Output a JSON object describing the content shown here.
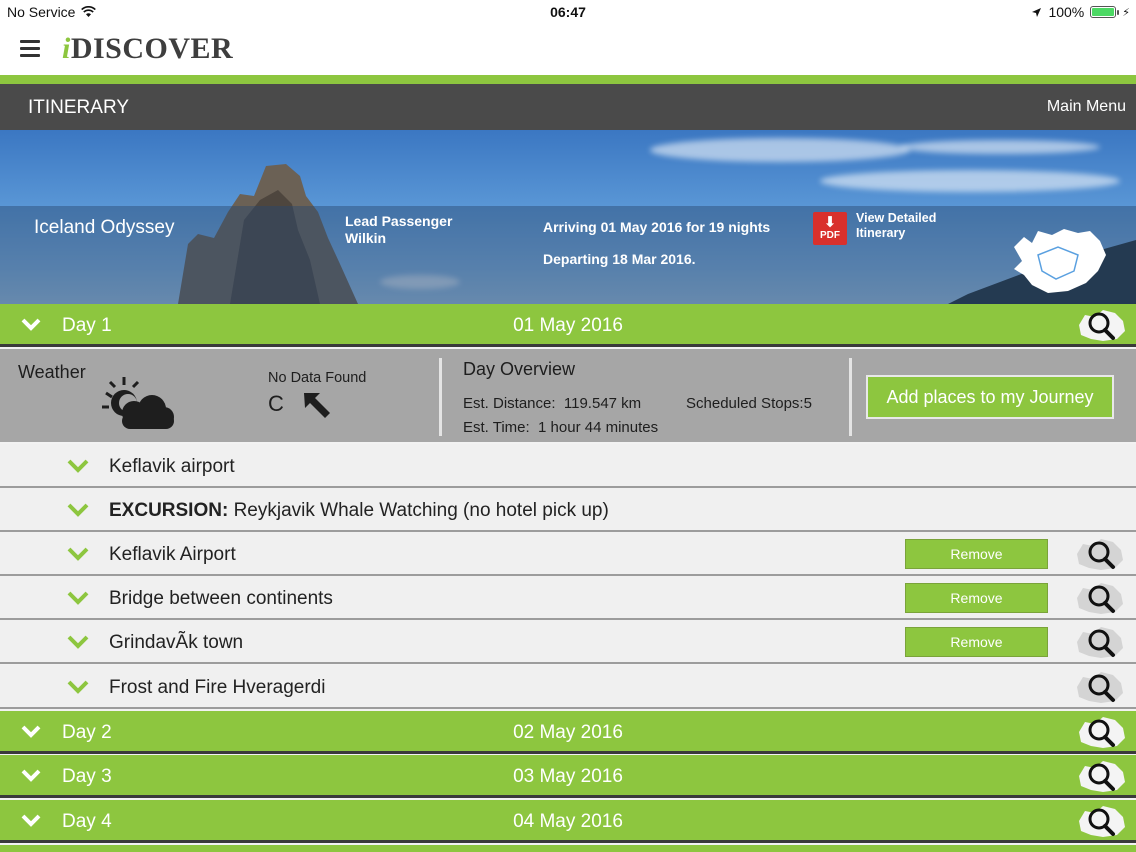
{
  "status_bar": {
    "carrier": "No Service",
    "time": "06:47",
    "battery": "100%"
  },
  "app": {
    "logo_i": "i",
    "logo_rest": "DISCOVER"
  },
  "titlebar": {
    "title": "ITINERARY",
    "main_menu": "Main Menu"
  },
  "hero": {
    "trip_name": "Iceland Odyssey",
    "lead_label": "Lead Passenger",
    "lead_name": "Wilkin",
    "arriving": "Arriving 01 May 2016 for 19 nights",
    "departing": "Departing 18 Mar 2016.",
    "pdf_label": "PDF",
    "view_line1": "View Detailed",
    "view_line2": "Itinerary"
  },
  "days": [
    {
      "day": "Day 1",
      "date": "01 May 2016"
    },
    {
      "day": "Day 2",
      "date": "02 May 2016"
    },
    {
      "day": "Day 3",
      "date": "03 May 2016"
    },
    {
      "day": "Day 4",
      "date": "04 May 2016"
    }
  ],
  "overview": {
    "weather_label": "Weather",
    "no_data": "No Data Found",
    "unit": "C",
    "title": "Day Overview",
    "est_distance_label": "Est. Distance:",
    "est_distance": "119.547 km",
    "est_time_label": "Est. Time:",
    "est_time": "1 hour 44 minutes",
    "stops_label": "Scheduled Stops:",
    "stops": "5",
    "add_button": "Add places to my Journey"
  },
  "stops": [
    {
      "prefix": "",
      "name": "Keflavik airport",
      "remove": false,
      "search": false
    },
    {
      "prefix": "EXCURSION:",
      "name": " Reykjavik Whale Watching  (no hotel pick up)",
      "remove": false,
      "search": false
    },
    {
      "prefix": "",
      "name": "Keflavik Airport",
      "remove": true,
      "search": true
    },
    {
      "prefix": "",
      "name": "Bridge between continents",
      "remove": true,
      "search": true
    },
    {
      "prefix": "",
      "name": "GrindavÃk town",
      "remove": true,
      "search": true
    },
    {
      "prefix": "",
      "name": "Frost and Fire Hveragerdi",
      "remove": false,
      "search": true
    }
  ],
  "remove_label": "Remove",
  "colors": {
    "accent": "#8dc63f",
    "titlebar": "#4a4a4a",
    "overview": "#a6a6a6"
  }
}
